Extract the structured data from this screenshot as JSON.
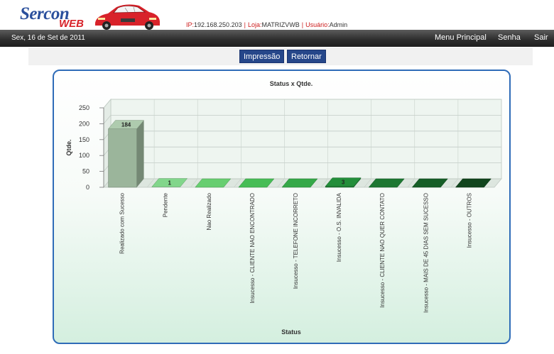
{
  "header": {
    "logo_main": "Sercon",
    "logo_sub": "WEB",
    "ip_label": "IP:",
    "ip_value": "192.168.250.203",
    "loja_label": "Loja:",
    "loja_value": "MATRIZVWB",
    "usuario_label": "Usuário:",
    "usuario_value": "Admin"
  },
  "navbar": {
    "date": "Sex, 16 de Set de 2011",
    "menu_principal": "Menu Principal",
    "senha": "Senha",
    "sair": "Sair"
  },
  "toolbar": {
    "impressao": "Impressão",
    "retornar": "Retornar"
  },
  "chart_data": {
    "type": "bar",
    "title": "Status x Qtde.",
    "xlabel": "Status",
    "ylabel": "Qtde.",
    "ylim": [
      0,
      250
    ],
    "yticks": [
      "0",
      "50",
      "100",
      "150",
      "200",
      "250"
    ],
    "categories": [
      "Realizado com Sucesso",
      "Pendente",
      "Nao Realizado",
      "Insucesso - CLIENTE NAO ENCONTRADO",
      "Insucesso - TELEFONE INCORRETO",
      "Insucesso - O.S. INVALIDA",
      "Insucesso - CLIENTE NAO QUER CONTATO",
      "Insucesso - MAIS DE 45 DIAS SEM SUCESSO",
      "Insucesso - OUTROS"
    ],
    "values": [
      184,
      1,
      0,
      0,
      0,
      3,
      0,
      0,
      0
    ],
    "data_labels": [
      "184",
      "1",
      "",
      "",
      "",
      "3",
      "",
      "",
      ""
    ],
    "colors": [
      "#9bb59b",
      "#74bf7c",
      "#5cb864",
      "#3fa94d",
      "#2f9640",
      "#1f7f34",
      "#1a6a2d",
      "#145423",
      "#0f3e1a"
    ],
    "grid": true
  }
}
